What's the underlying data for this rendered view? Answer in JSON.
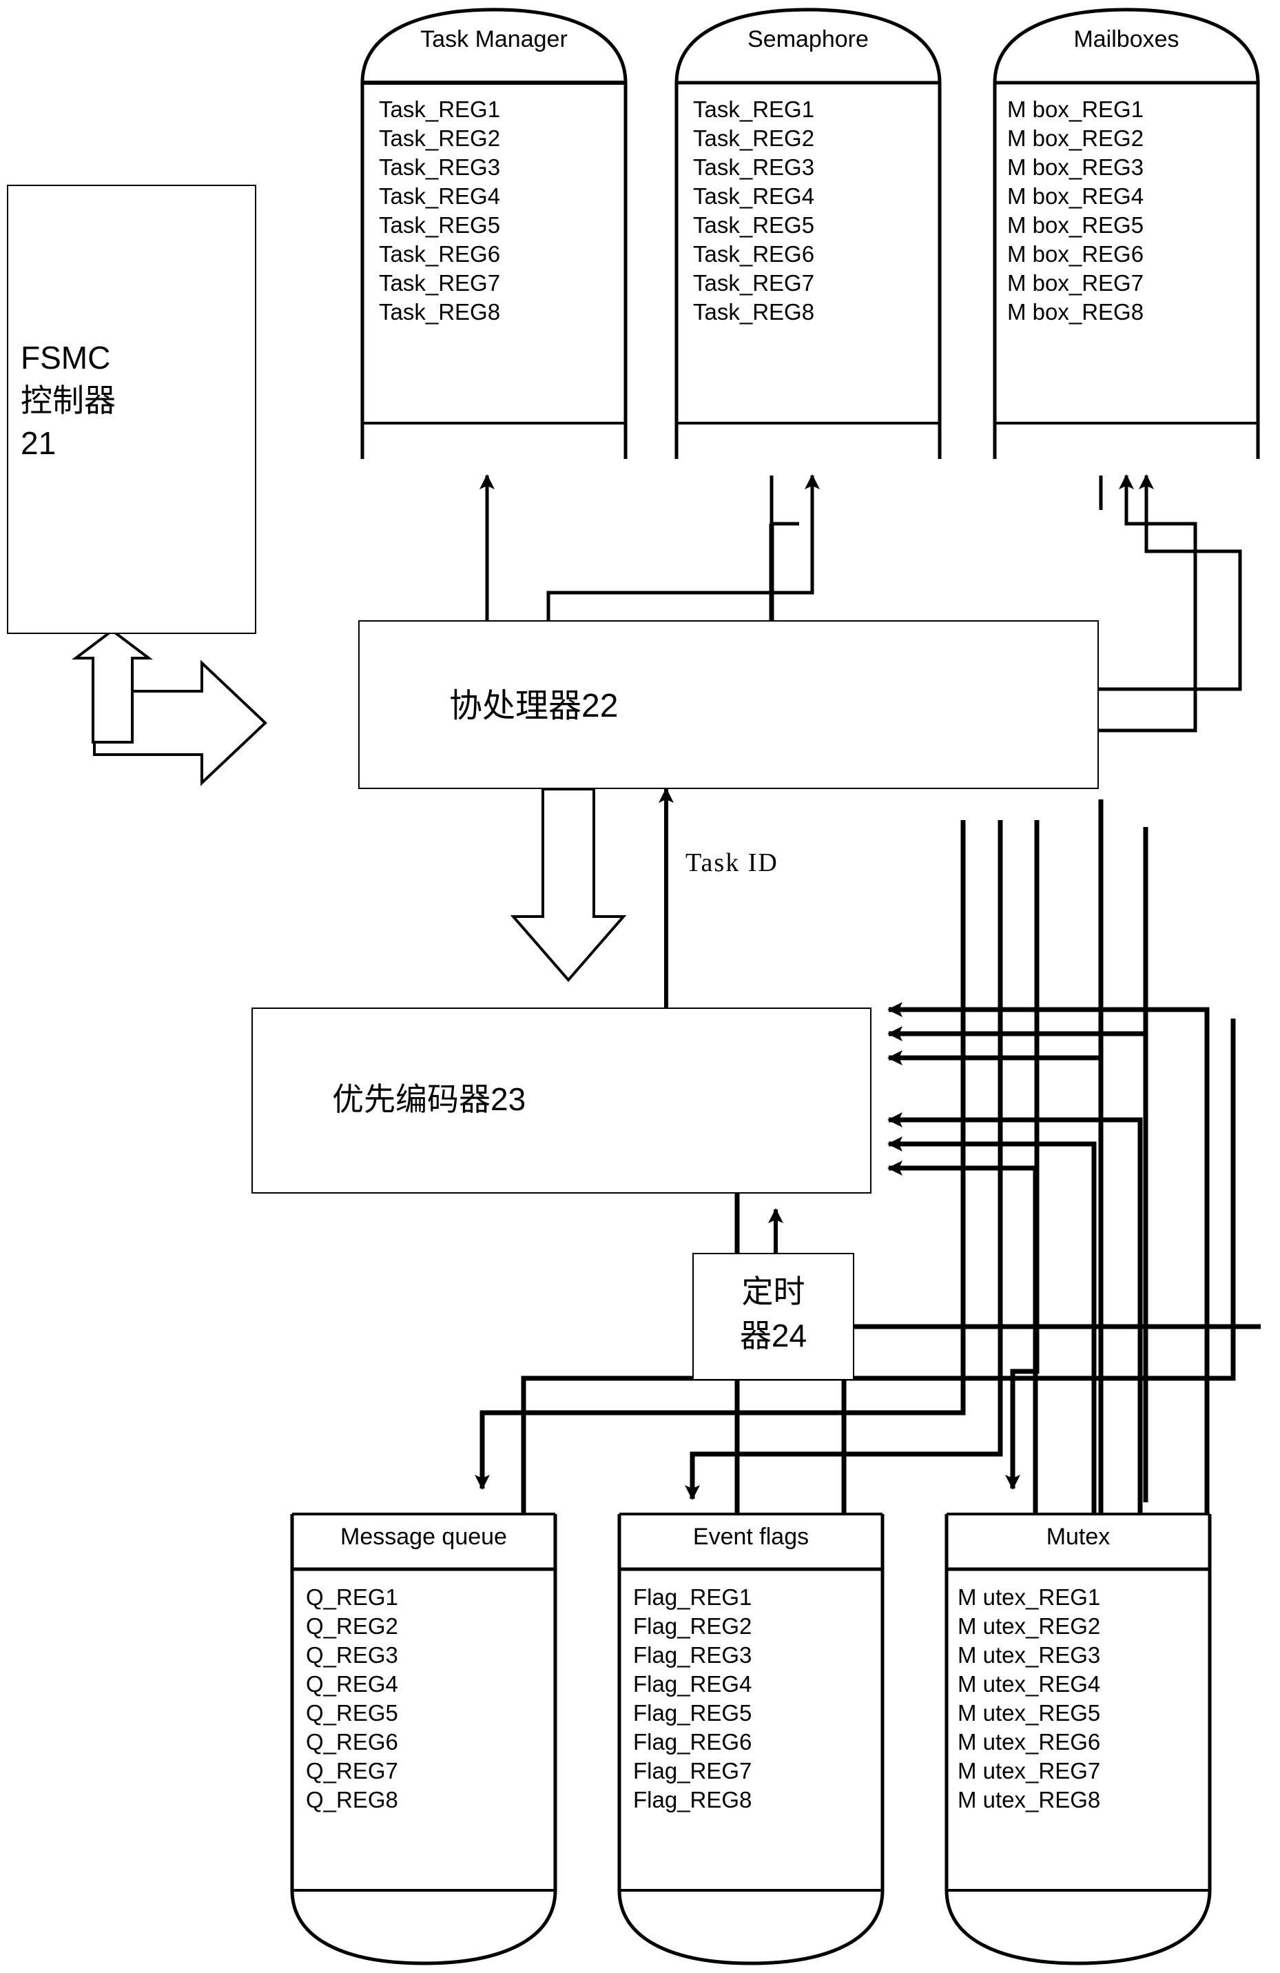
{
  "diagram": {
    "title_number": "21",
    "blocks": {
      "fsmc": {
        "label": "FSMC\n控制器\n21"
      },
      "coprocessor": {
        "label": "协处理器22"
      },
      "priority_encoder": {
        "label": "优先编码器23"
      },
      "timer": {
        "label": "定时\n器24"
      }
    },
    "wire_labels": {
      "task_id": "Task ID"
    },
    "register_blocks": [
      {
        "id": "task-manager",
        "title": "Task Manager",
        "registers": [
          "Task_REG1",
          "Task_REG2",
          "Task_REG3",
          "Task_REG4",
          "Task_REG5",
          "Task_REG6",
          "Task_REG7",
          "Task_REG8"
        ]
      },
      {
        "id": "semaphore",
        "title": "Semaphore",
        "registers": [
          "Task_REG1",
          "Task_REG2",
          "Task_REG3",
          "Task_REG4",
          "Task_REG5",
          "Task_REG6",
          "Task_REG7",
          "Task_REG8"
        ]
      },
      {
        "id": "mailboxes",
        "title": "Mailboxes",
        "registers": [
          "M box_REG1",
          "M box_REG2",
          "M box_REG3",
          "M box_REG4",
          "M box_REG5",
          "M box_REG6",
          "M box_REG7",
          "M box_REG8"
        ]
      },
      {
        "id": "message-queue",
        "title": "Message queue",
        "registers": [
          "Q_REG1",
          "Q_REG2",
          "Q_REG3",
          "Q_REG4",
          "Q_REG5",
          "Q_REG6",
          "Q_REG7",
          "Q_REG8"
        ]
      },
      {
        "id": "event-flags",
        "title": "Event flags",
        "registers": [
          "Flag_REG1",
          "Flag_REG2",
          "Flag_REG3",
          "Flag_REG4",
          "Flag_REG5",
          "Flag_REG6",
          "Flag_REG7",
          "Flag_REG8"
        ]
      },
      {
        "id": "mutex",
        "title": "Mutex",
        "registers": [
          "M utex_REG1",
          "M utex_REG2",
          "M utex_REG3",
          "M utex_REG4",
          "M utex_REG5",
          "M utex_REG6",
          "M utex_REG7",
          "M utex_REG8"
        ]
      }
    ],
    "colors": {
      "stroke": "#000000",
      "background": "#ffffff"
    }
  }
}
